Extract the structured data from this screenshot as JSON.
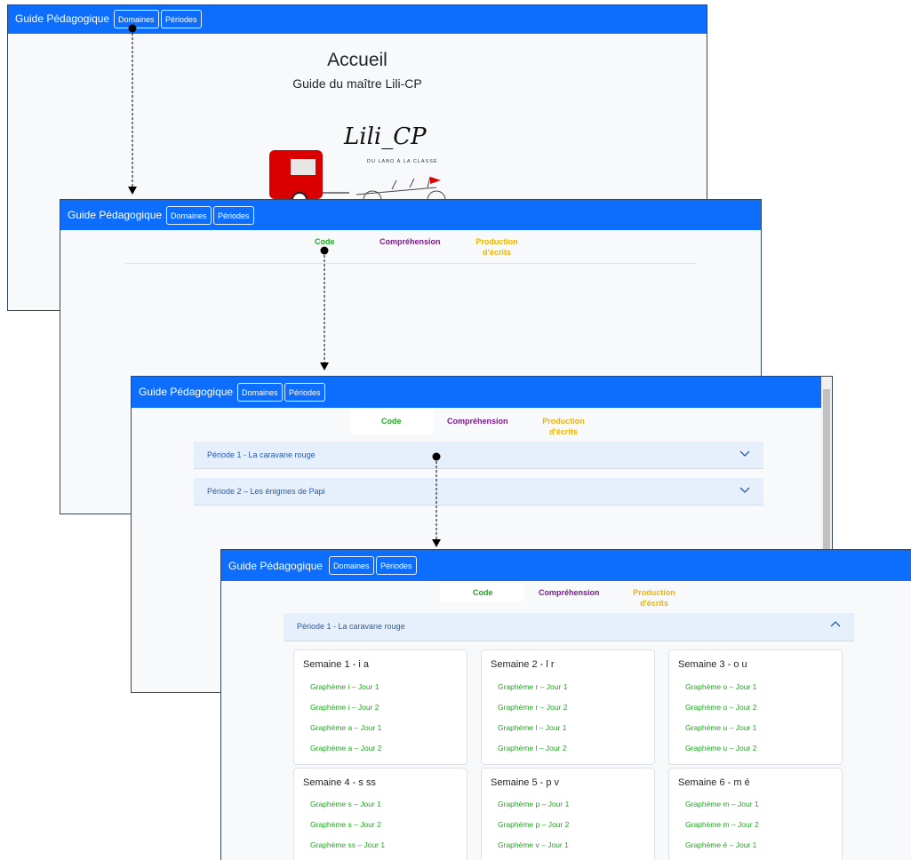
{
  "nav": {
    "brand": "Guide Pédagogique",
    "domaines": "Domaines",
    "periodes": "Périodes"
  },
  "home": {
    "title": "Accueil",
    "subtitle": "Guide du maître Lili-CP",
    "logo_text": "Lili_CP",
    "logo_tagline": "DU LABO À LA CLASSE"
  },
  "tabs": {
    "code": "Code",
    "comprehension": "Compréhension",
    "production_line1": "Production",
    "production_line2": "d'écrits"
  },
  "periods": [
    {
      "label": "Période 1 - La caravane rouge"
    },
    {
      "label": "Période 2 – Les énigmes de Papi"
    }
  ],
  "weeks": [
    {
      "title": "Semaine 1 - i a",
      "items": [
        "Graphème i – Jour 1",
        "Graphème i – Jour 2",
        "Graphème a – Jour 1",
        "Graphème a – Jour 2"
      ]
    },
    {
      "title": "Semaine 2 - l r",
      "items": [
        "Graphème r – Jour 1",
        "Graphème r – Jour 2",
        "Graphème l – Jour 1",
        "Graphème l – Jour 2"
      ]
    },
    {
      "title": "Semaine 3 - o u",
      "items": [
        "Graphème o – Jour 1",
        "Graphème o – Jour 2",
        "Graphème u – Jour 1",
        "Graphème u – Jour 2"
      ]
    },
    {
      "title": "Semaine 4 - s ss",
      "items": [
        "Graphème s – Jour 1",
        "Graphème s – Jour 2",
        "Graphème ss – Jour 1"
      ]
    },
    {
      "title": "Semaine 5 - p v",
      "items": [
        "Graphème p – Jour 1",
        "Graphème p – Jour 2",
        "Graphème v – Jour 1"
      ]
    },
    {
      "title": "Semaine 6 - m é",
      "items": [
        "Graphème m – Jour 1",
        "Graphème m – Jour 2",
        "Graphème é – Jour 1"
      ]
    }
  ],
  "colors": {
    "navbar": "#0d6efd",
    "code": "#1fa81f",
    "comprehension": "#7b1a8c",
    "production": "#f0b400",
    "accordion": "#e6f0fc"
  }
}
